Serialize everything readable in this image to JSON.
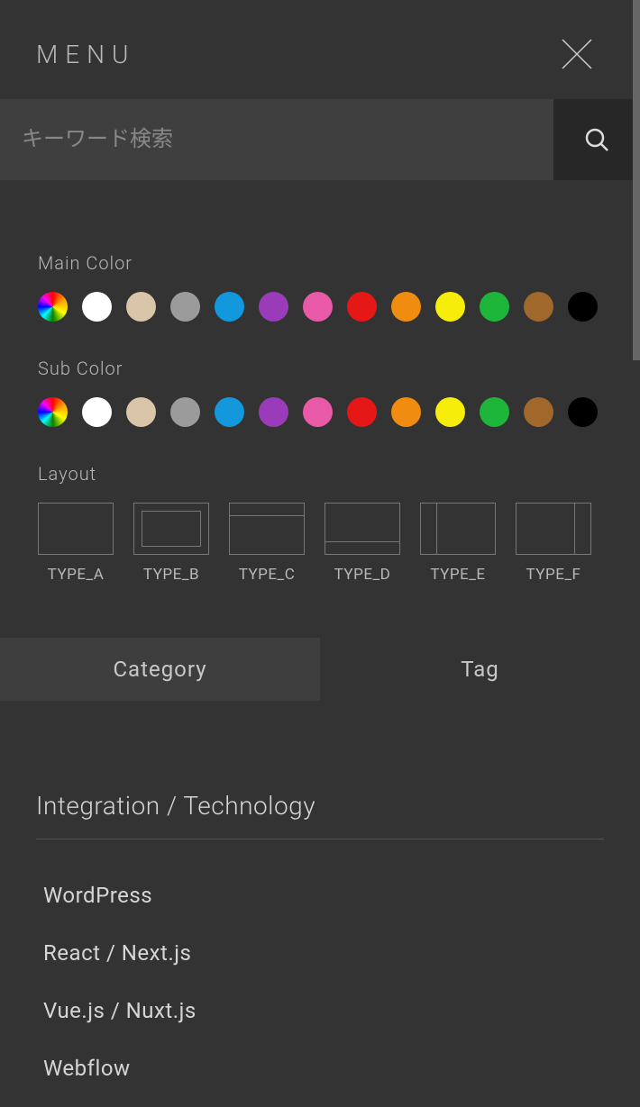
{
  "header": {
    "title": "MENU"
  },
  "search": {
    "placeholder": "キーワード検索"
  },
  "filters": {
    "main_color_label": "Main Color",
    "sub_color_label": "Sub Color",
    "layout_label": "Layout",
    "colors": [
      {
        "name": "rainbow",
        "css": "rainbow"
      },
      {
        "name": "white",
        "hex": "#ffffff"
      },
      {
        "name": "beige",
        "hex": "#d9c5a8"
      },
      {
        "name": "gray",
        "hex": "#9b9b9b"
      },
      {
        "name": "blue",
        "hex": "#1398dd"
      },
      {
        "name": "purple",
        "hex": "#9a3cb9"
      },
      {
        "name": "pink",
        "hex": "#e85aa8"
      },
      {
        "name": "red",
        "hex": "#e61717"
      },
      {
        "name": "orange",
        "hex": "#f08c0f"
      },
      {
        "name": "yellow",
        "hex": "#f7ed0a"
      },
      {
        "name": "green",
        "hex": "#1eb63a"
      },
      {
        "name": "brown",
        "hex": "#a0682a"
      },
      {
        "name": "black",
        "hex": "#000000"
      }
    ],
    "layouts": [
      {
        "id": "a",
        "label": "TYPE_A"
      },
      {
        "id": "b",
        "label": "TYPE_B"
      },
      {
        "id": "c",
        "label": "TYPE_C"
      },
      {
        "id": "d",
        "label": "TYPE_D"
      },
      {
        "id": "e",
        "label": "TYPE_E"
      },
      {
        "id": "f",
        "label": "TYPE_F"
      }
    ]
  },
  "tabs": {
    "category": "Category",
    "tag": "Tag",
    "active": "tag"
  },
  "section": {
    "title": "Integration / Technology",
    "tags": [
      "WordPress",
      "React / Next.js",
      "Vue.js / Nuxt.js",
      "Webflow"
    ]
  }
}
